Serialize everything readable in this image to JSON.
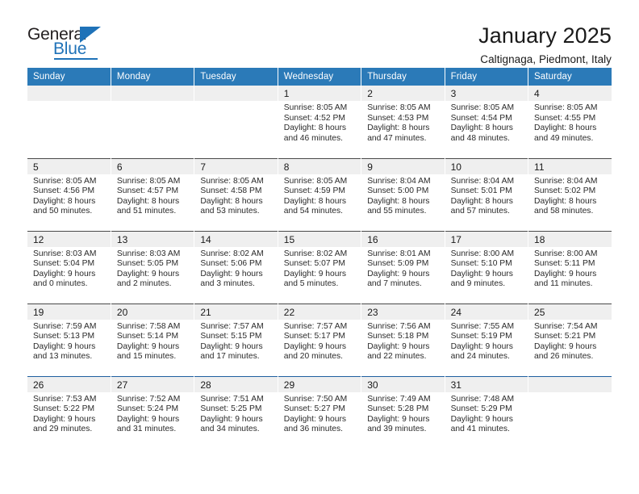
{
  "brand": {
    "name_top": "General",
    "name_bottom": "Blue",
    "accent_color": "#1f72b8",
    "triangle_icon": "triangle-icon"
  },
  "header": {
    "title": "January 2025",
    "location": "Caltignaga, Piedmont, Italy"
  },
  "calendar": {
    "header_bg": "#2b7ab8",
    "daynum_bg": "#efefef",
    "weekdays": [
      "Sunday",
      "Monday",
      "Tuesday",
      "Wednesday",
      "Thursday",
      "Friday",
      "Saturday"
    ],
    "weeks": [
      [
        {
          "day": "",
          "sunrise": "",
          "sunset": "",
          "daylight1": "",
          "daylight2": "",
          "empty": true
        },
        {
          "day": "",
          "sunrise": "",
          "sunset": "",
          "daylight1": "",
          "daylight2": "",
          "empty": true
        },
        {
          "day": "",
          "sunrise": "",
          "sunset": "",
          "daylight1": "",
          "daylight2": "",
          "empty": true
        },
        {
          "day": "1",
          "sunrise": "Sunrise: 8:05 AM",
          "sunset": "Sunset: 4:52 PM",
          "daylight1": "Daylight: 8 hours",
          "daylight2": "and 46 minutes."
        },
        {
          "day": "2",
          "sunrise": "Sunrise: 8:05 AM",
          "sunset": "Sunset: 4:53 PM",
          "daylight1": "Daylight: 8 hours",
          "daylight2": "and 47 minutes."
        },
        {
          "day": "3",
          "sunrise": "Sunrise: 8:05 AM",
          "sunset": "Sunset: 4:54 PM",
          "daylight1": "Daylight: 8 hours",
          "daylight2": "and 48 minutes."
        },
        {
          "day": "4",
          "sunrise": "Sunrise: 8:05 AM",
          "sunset": "Sunset: 4:55 PM",
          "daylight1": "Daylight: 8 hours",
          "daylight2": "and 49 minutes."
        }
      ],
      [
        {
          "day": "5",
          "sunrise": "Sunrise: 8:05 AM",
          "sunset": "Sunset: 4:56 PM",
          "daylight1": "Daylight: 8 hours",
          "daylight2": "and 50 minutes."
        },
        {
          "day": "6",
          "sunrise": "Sunrise: 8:05 AM",
          "sunset": "Sunset: 4:57 PM",
          "daylight1": "Daylight: 8 hours",
          "daylight2": "and 51 minutes."
        },
        {
          "day": "7",
          "sunrise": "Sunrise: 8:05 AM",
          "sunset": "Sunset: 4:58 PM",
          "daylight1": "Daylight: 8 hours",
          "daylight2": "and 53 minutes."
        },
        {
          "day": "8",
          "sunrise": "Sunrise: 8:05 AM",
          "sunset": "Sunset: 4:59 PM",
          "daylight1": "Daylight: 8 hours",
          "daylight2": "and 54 minutes."
        },
        {
          "day": "9",
          "sunrise": "Sunrise: 8:04 AM",
          "sunset": "Sunset: 5:00 PM",
          "daylight1": "Daylight: 8 hours",
          "daylight2": "and 55 minutes."
        },
        {
          "day": "10",
          "sunrise": "Sunrise: 8:04 AM",
          "sunset": "Sunset: 5:01 PM",
          "daylight1": "Daylight: 8 hours",
          "daylight2": "and 57 minutes."
        },
        {
          "day": "11",
          "sunrise": "Sunrise: 8:04 AM",
          "sunset": "Sunset: 5:02 PM",
          "daylight1": "Daylight: 8 hours",
          "daylight2": "and 58 minutes."
        }
      ],
      [
        {
          "day": "12",
          "sunrise": "Sunrise: 8:03 AM",
          "sunset": "Sunset: 5:04 PM",
          "daylight1": "Daylight: 9 hours",
          "daylight2": "and 0 minutes."
        },
        {
          "day": "13",
          "sunrise": "Sunrise: 8:03 AM",
          "sunset": "Sunset: 5:05 PM",
          "daylight1": "Daylight: 9 hours",
          "daylight2": "and 2 minutes."
        },
        {
          "day": "14",
          "sunrise": "Sunrise: 8:02 AM",
          "sunset": "Sunset: 5:06 PM",
          "daylight1": "Daylight: 9 hours",
          "daylight2": "and 3 minutes."
        },
        {
          "day": "15",
          "sunrise": "Sunrise: 8:02 AM",
          "sunset": "Sunset: 5:07 PM",
          "daylight1": "Daylight: 9 hours",
          "daylight2": "and 5 minutes."
        },
        {
          "day": "16",
          "sunrise": "Sunrise: 8:01 AM",
          "sunset": "Sunset: 5:09 PM",
          "daylight1": "Daylight: 9 hours",
          "daylight2": "and 7 minutes."
        },
        {
          "day": "17",
          "sunrise": "Sunrise: 8:00 AM",
          "sunset": "Sunset: 5:10 PM",
          "daylight1": "Daylight: 9 hours",
          "daylight2": "and 9 minutes."
        },
        {
          "day": "18",
          "sunrise": "Sunrise: 8:00 AM",
          "sunset": "Sunset: 5:11 PM",
          "daylight1": "Daylight: 9 hours",
          "daylight2": "and 11 minutes."
        }
      ],
      [
        {
          "day": "19",
          "sunrise": "Sunrise: 7:59 AM",
          "sunset": "Sunset: 5:13 PM",
          "daylight1": "Daylight: 9 hours",
          "daylight2": "and 13 minutes."
        },
        {
          "day": "20",
          "sunrise": "Sunrise: 7:58 AM",
          "sunset": "Sunset: 5:14 PM",
          "daylight1": "Daylight: 9 hours",
          "daylight2": "and 15 minutes."
        },
        {
          "day": "21",
          "sunrise": "Sunrise: 7:57 AM",
          "sunset": "Sunset: 5:15 PM",
          "daylight1": "Daylight: 9 hours",
          "daylight2": "and 17 minutes."
        },
        {
          "day": "22",
          "sunrise": "Sunrise: 7:57 AM",
          "sunset": "Sunset: 5:17 PM",
          "daylight1": "Daylight: 9 hours",
          "daylight2": "and 20 minutes."
        },
        {
          "day": "23",
          "sunrise": "Sunrise: 7:56 AM",
          "sunset": "Sunset: 5:18 PM",
          "daylight1": "Daylight: 9 hours",
          "daylight2": "and 22 minutes."
        },
        {
          "day": "24",
          "sunrise": "Sunrise: 7:55 AM",
          "sunset": "Sunset: 5:19 PM",
          "daylight1": "Daylight: 9 hours",
          "daylight2": "and 24 minutes."
        },
        {
          "day": "25",
          "sunrise": "Sunrise: 7:54 AM",
          "sunset": "Sunset: 5:21 PM",
          "daylight1": "Daylight: 9 hours",
          "daylight2": "and 26 minutes."
        }
      ],
      [
        {
          "day": "26",
          "sunrise": "Sunrise: 7:53 AM",
          "sunset": "Sunset: 5:22 PM",
          "daylight1": "Daylight: 9 hours",
          "daylight2": "and 29 minutes."
        },
        {
          "day": "27",
          "sunrise": "Sunrise: 7:52 AM",
          "sunset": "Sunset: 5:24 PM",
          "daylight1": "Daylight: 9 hours",
          "daylight2": "and 31 minutes."
        },
        {
          "day": "28",
          "sunrise": "Sunrise: 7:51 AM",
          "sunset": "Sunset: 5:25 PM",
          "daylight1": "Daylight: 9 hours",
          "daylight2": "and 34 minutes."
        },
        {
          "day": "29",
          "sunrise": "Sunrise: 7:50 AM",
          "sunset": "Sunset: 5:27 PM",
          "daylight1": "Daylight: 9 hours",
          "daylight2": "and 36 minutes."
        },
        {
          "day": "30",
          "sunrise": "Sunrise: 7:49 AM",
          "sunset": "Sunset: 5:28 PM",
          "daylight1": "Daylight: 9 hours",
          "daylight2": "and 39 minutes."
        },
        {
          "day": "31",
          "sunrise": "Sunrise: 7:48 AM",
          "sunset": "Sunset: 5:29 PM",
          "daylight1": "Daylight: 9 hours",
          "daylight2": "and 41 minutes."
        },
        {
          "day": "",
          "sunrise": "",
          "sunset": "",
          "daylight1": "",
          "daylight2": "",
          "empty": true
        }
      ]
    ]
  }
}
